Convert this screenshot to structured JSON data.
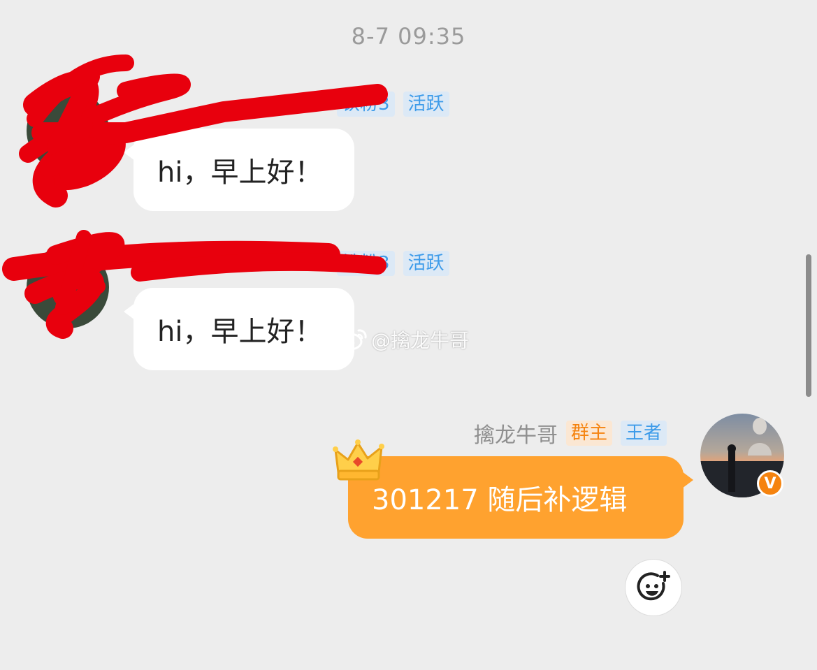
{
  "timestamp": "8-7 09:35",
  "messages": [
    {
      "badges": [
        "铁粉3",
        "活跃"
      ],
      "text": "hi，早上好！"
    },
    {
      "badges": [
        "铁粉3",
        "活跃"
      ],
      "text": "hi，早上好！"
    },
    {
      "sender": "擒龙牛哥",
      "badges": [
        "群主",
        "王者"
      ],
      "text": "301217  随后补逻辑"
    }
  ],
  "watermark": "@擒龙牛哥",
  "icons": {
    "crown": "crown-icon",
    "verified": "verified-v-icon",
    "emoji_add": "emoji-add-icon",
    "weibo": "weibo-logo-icon"
  },
  "verified_letter": "V",
  "colors": {
    "background": "#ededed",
    "bubble_self": "#ffa22f",
    "bubble_other": "#ffffff",
    "badge_blue_text": "#3d9be9",
    "badge_orange_text": "#f5830f",
    "scribble": "#e8000d"
  }
}
